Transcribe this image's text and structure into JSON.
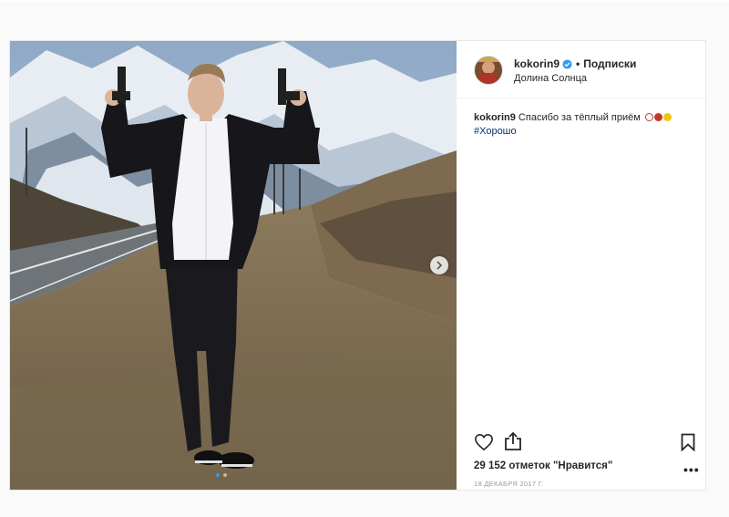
{
  "post": {
    "username": "kokorin9",
    "separator": "•",
    "follow_label": "Подписки",
    "location": "Долина Солнца",
    "caption_user": "kokorin9",
    "caption_text": "Спасибо за тёплый приём",
    "hashtag": "#Хорошо",
    "likes_text": "29 152 отметок \"Нравится\"",
    "date": "18 ДЕКАБРЯ 2017 Г.",
    "more_label": "•••"
  },
  "icons": {
    "verified": "verified-badge-icon",
    "like": "heart-icon",
    "share": "share-icon",
    "save": "bookmark-icon",
    "next": "chevron-right-icon"
  },
  "colors": {
    "verified": "#3897f0",
    "hashtag": "#003569",
    "text": "#262626",
    "date": "#999999"
  }
}
